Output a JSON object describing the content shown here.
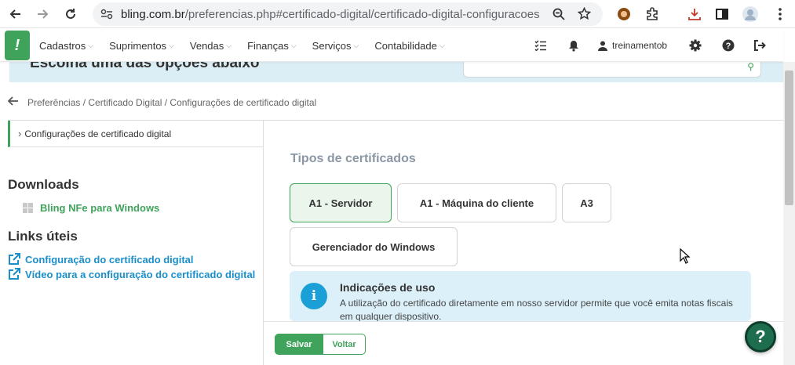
{
  "browser": {
    "url_host": "bling.com.br",
    "url_path": "/preferencias.php#certificado-digital/certificado-digital-configuracoes"
  },
  "header": {
    "menu": [
      "Cadastros",
      "Suprimentos",
      "Vendas",
      "Finanças",
      "Serviços",
      "Contabilidade"
    ],
    "username": "treinamentob",
    "brand_color": "#3fa35b"
  },
  "banner": {
    "title": "Escolha uma das opções abaixo"
  },
  "breadcrumb": "Preferências / Certificado Digital / Configurações de certificado digital",
  "sidebar": {
    "nav_item": "Configurações de certificado digital",
    "downloads_title": "Downloads",
    "download_link": "Bling NFe para Windows",
    "links_title": "Links úteis",
    "links": [
      "Configuração do certificado digital",
      "Vídeo para a configuração do certificado digital"
    ]
  },
  "main": {
    "types_title": "Tipos de certificados",
    "cert_types": [
      "A1 - Servidor",
      "A1 - Máquina do cliente",
      "A3",
      "Gerenciador do Windows"
    ],
    "selected": "A1 - Servidor",
    "info": {
      "icon": "i",
      "title": "Indicações de uso",
      "text": "A utilização do certificado diretamente em nosso servidor permite que você emita notas fiscais em qualquer dispositivo."
    }
  },
  "footer": {
    "save_label": "Salvar",
    "back_label": "Voltar"
  },
  "help": {
    "label": "?"
  }
}
